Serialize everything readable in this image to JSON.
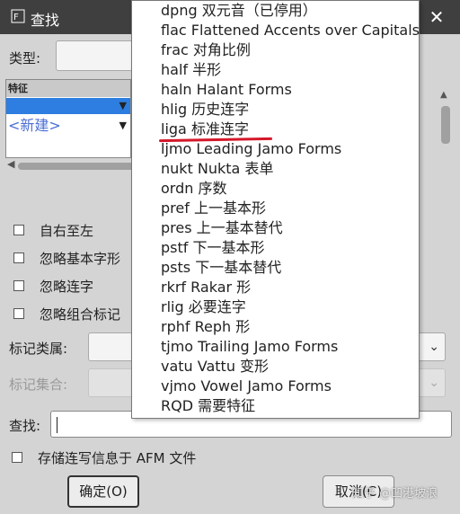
{
  "window": {
    "title": "查找",
    "close_glyph": "✕"
  },
  "form": {
    "type_label": "类型:",
    "feature_header": "特征",
    "new_row": "<新建>",
    "checkboxes": [
      "自右至左",
      "忽略基本字形",
      "忽略连字",
      "忽略组合标记"
    ],
    "mark_class_label": "标记类属:",
    "mark_set_label": "标记集合:",
    "find_label": "查找:",
    "afm_checkbox": "存储连写信息于 AFM 文件",
    "ok_button": "确定(O)",
    "cancel_button": "取消(C)"
  },
  "feature_list": [
    "dpng 双元音（已停用）",
    "flac Flattened Accents over Capitals",
    "frac 对角比例",
    "half 半形",
    "haln Halant Forms",
    "hlig 历史连字",
    "liga 标准连字",
    "ljmo Leading Jamo Forms",
    "nukt Nukta 表单",
    "ordn 序数",
    "pref 上一基本形",
    "pres 上一基本替代",
    "pstf 下一基本形",
    "psts 下一基本替代",
    "rkrf Rakar 形",
    "rlig 必要连字",
    "rphf Reph 形",
    "tjmo Trailing Jamo Forms",
    "vatu Vattu 变形",
    "vjmo Vowel Jamo Forms",
    " RQD 需要特征"
  ],
  "watermark": "知乎 @凹港坡浪",
  "icons": {
    "app": "fontforge-icon",
    "dropdown": "chevron-down-icon"
  },
  "colors": {
    "titlebar": "#3f3f3f",
    "selection": "#2d7ee0",
    "annotation_underline": "#d4182a",
    "new_row_text": "#4b6ed6"
  }
}
